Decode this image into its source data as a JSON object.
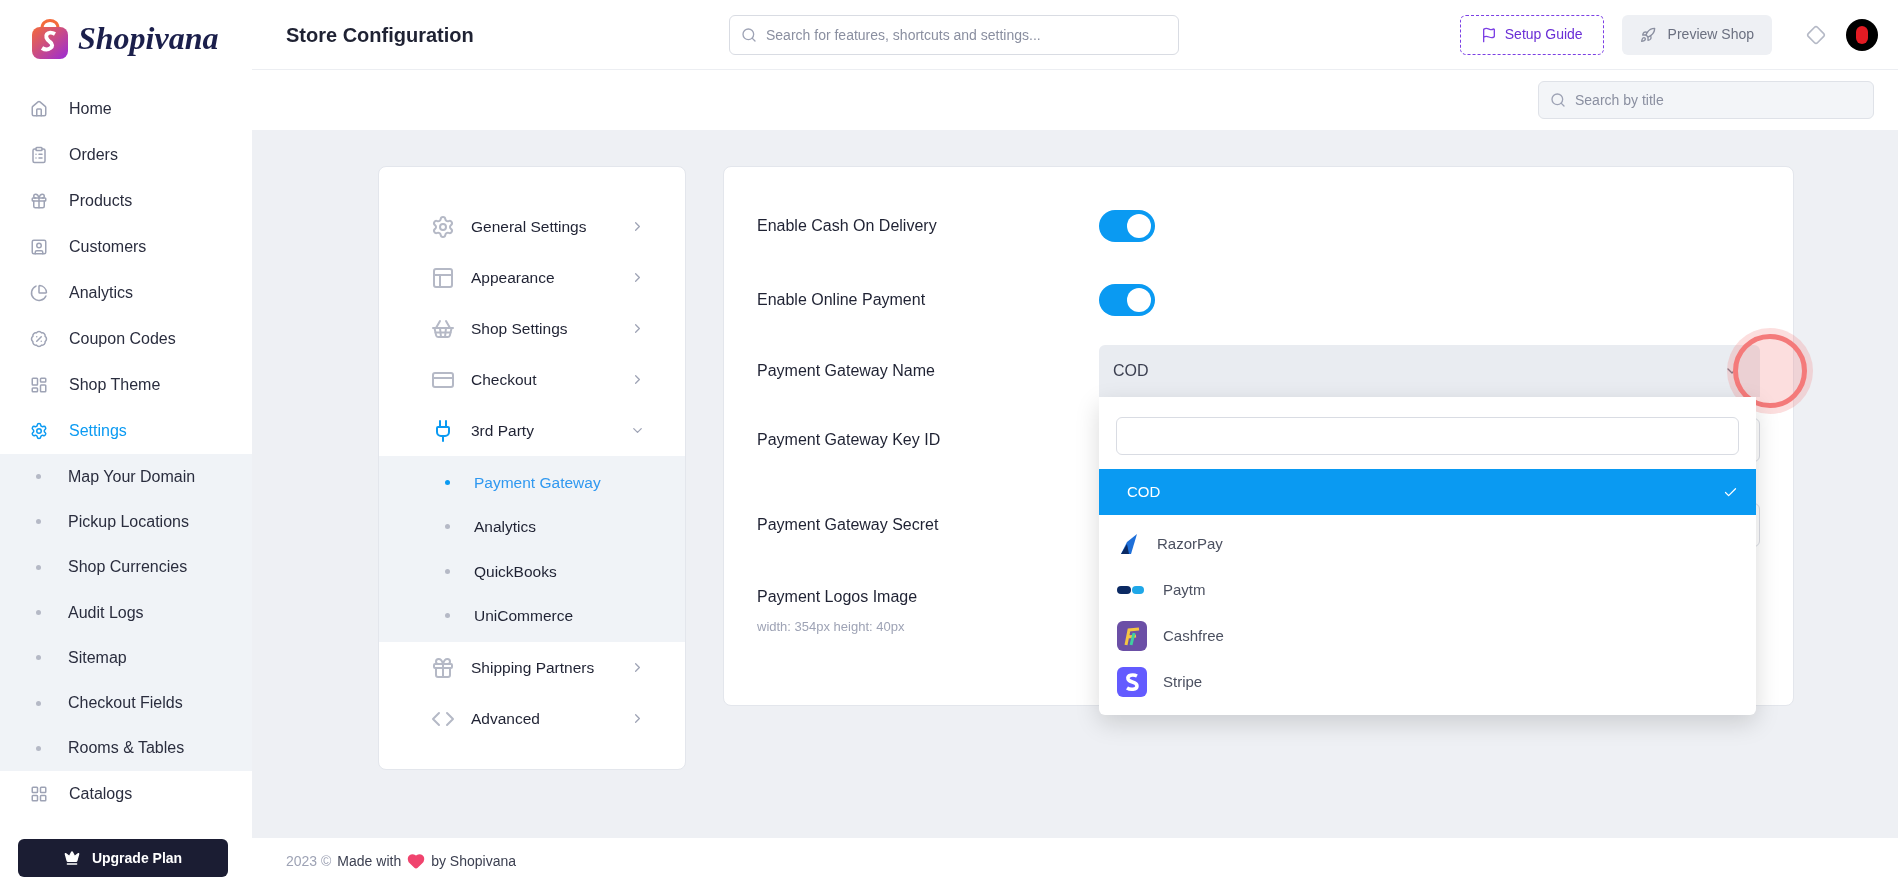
{
  "brand": {
    "name": "Shopivana"
  },
  "sidebar": {
    "items": [
      {
        "label": "Home",
        "kind": "home",
        "selected": false
      },
      {
        "label": "Orders",
        "kind": "orders",
        "selected": false
      },
      {
        "label": "Products",
        "kind": "products",
        "selected": false
      },
      {
        "label": "Customers",
        "kind": "customers",
        "selected": false
      },
      {
        "label": "Analytics",
        "kind": "analytics",
        "selected": false
      },
      {
        "label": "Coupon Codes",
        "kind": "coupon",
        "selected": false
      },
      {
        "label": "Shop Theme",
        "kind": "theme",
        "selected": false
      },
      {
        "label": "Settings",
        "kind": "settings",
        "selected": true,
        "expanded": true,
        "children": [
          {
            "label": "Map Your Domain",
            "selected": false
          },
          {
            "label": "Pickup Locations",
            "selected": false
          },
          {
            "label": "Shop Currencies",
            "selected": false
          },
          {
            "label": "Audit Logs",
            "selected": false
          },
          {
            "label": "Sitemap",
            "selected": false
          },
          {
            "label": "Checkout Fields",
            "selected": false
          },
          {
            "label": "Rooms & Tables",
            "selected": false
          }
        ]
      },
      {
        "label": "Catalogs",
        "kind": "catalogs",
        "selected": false
      }
    ],
    "upgrade_button": "Upgrade Plan"
  },
  "header": {
    "title": "Store Configuration",
    "search": {
      "placeholder": "Search for features, shortcuts and settings..."
    },
    "setup_button": "Setup Guide",
    "preview_button": "Preview Shop"
  },
  "subheader": {
    "search": {
      "placeholder": "Search by title"
    }
  },
  "settings_menu": {
    "items": [
      {
        "label": "General Settings",
        "kind": "gear",
        "expanded": false
      },
      {
        "label": "Appearance",
        "kind": "layout",
        "expanded": false
      },
      {
        "label": "Shop Settings",
        "kind": "basket",
        "expanded": false
      },
      {
        "label": "Checkout",
        "kind": "card",
        "expanded": false
      },
      {
        "label": "3rd Party",
        "kind": "plug",
        "expanded": true,
        "children": [
          {
            "label": "Payment Gateway",
            "selected": true
          },
          {
            "label": "Analytics",
            "selected": false
          },
          {
            "label": "QuickBooks",
            "selected": false
          },
          {
            "label": "UniCommerce",
            "selected": false
          }
        ]
      },
      {
        "label": "Shipping Partners",
        "kind": "gift",
        "expanded": false
      },
      {
        "label": "Advanced",
        "kind": "code",
        "expanded": false
      }
    ]
  },
  "form": {
    "rows": [
      {
        "kind": "toggle",
        "label": "Enable Cash On Delivery",
        "on": true
      },
      {
        "kind": "toggle",
        "label": "Enable Online Payment",
        "on": true
      },
      {
        "kind": "select",
        "label": "Payment Gateway Name",
        "value": "COD",
        "expanded": true,
        "options": [
          {
            "label": "COD",
            "kind": "none",
            "selected": true
          },
          {
            "label": "RazorPay",
            "kind": "razorpay",
            "selected": false
          },
          {
            "label": "Paytm",
            "kind": "paytm",
            "selected": false
          },
          {
            "label": "Cashfree",
            "kind": "cashfree",
            "selected": false
          },
          {
            "label": "Stripe",
            "kind": "stripe",
            "selected": false
          }
        ]
      },
      {
        "kind": "field",
        "label": "Payment Gateway Key ID"
      },
      {
        "kind": "field",
        "label": "Payment Gateway Secret"
      },
      {
        "kind": "image",
        "label": "Payment Logos Image",
        "hint": "width: 354px height: 40px"
      }
    ]
  },
  "footer": {
    "year": "2023 ©",
    "made_with": "Made with",
    "by": "by Shopivana"
  }
}
